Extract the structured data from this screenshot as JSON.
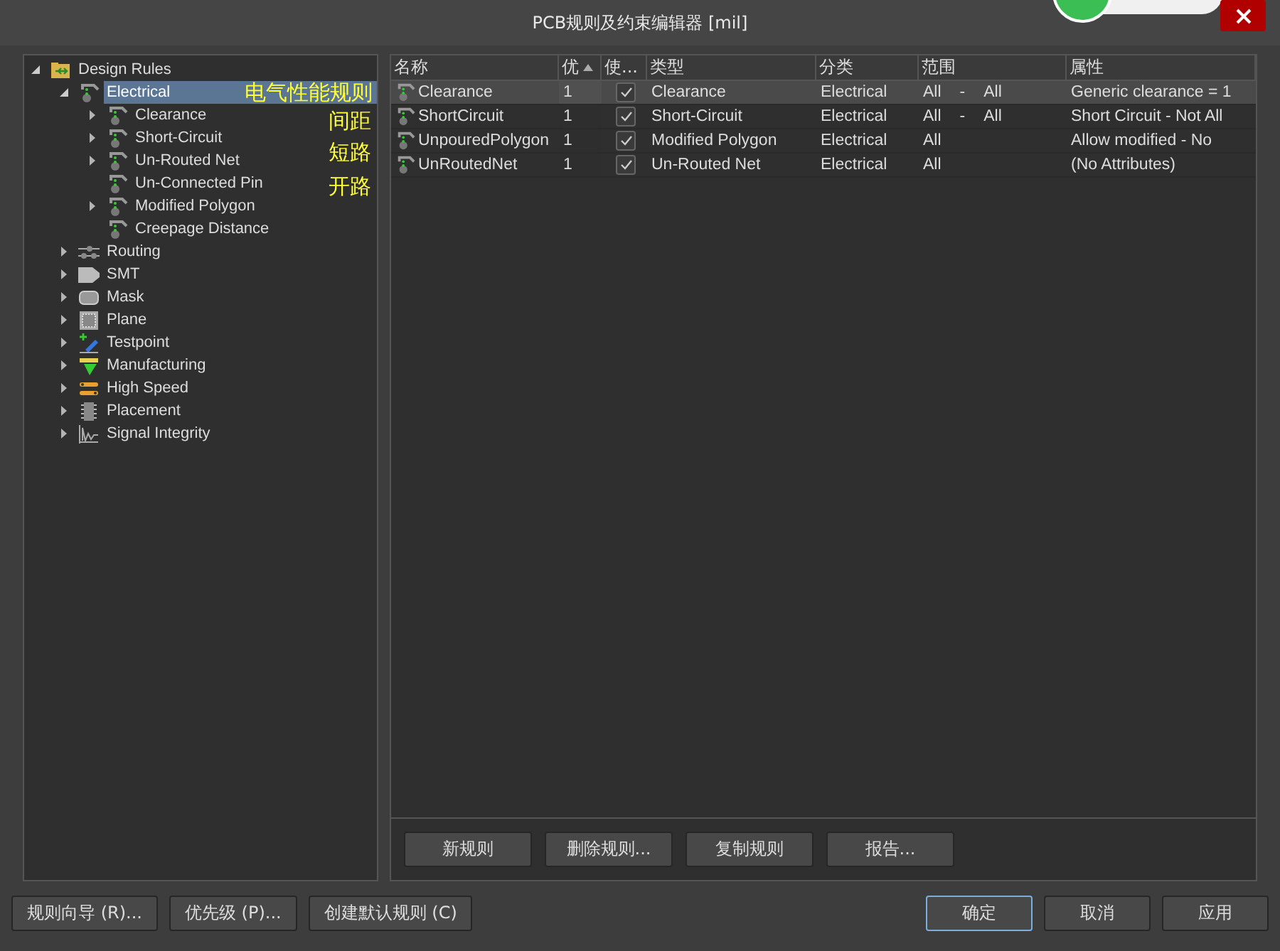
{
  "window": {
    "title": "PCB规则及约束编辑器 [mil]"
  },
  "tree": [
    {
      "label": "Design Rules",
      "kind": "folder",
      "expanded": true,
      "selected": false,
      "children": [
        {
          "label": "Electrical",
          "kind": "rule",
          "expanded": true,
          "selected": true,
          "children": [
            {
              "label": "Clearance",
              "kind": "rule",
              "expanded": false,
              "selected": false
            },
            {
              "label": "Short-Circuit",
              "kind": "rule",
              "expanded": false,
              "selected": false
            },
            {
              "label": "Un-Routed Net",
              "kind": "rule",
              "expanded": false,
              "selected": false
            },
            {
              "label": "Un-Connected Pin",
              "kind": "rule",
              "selected": false
            },
            {
              "label": "Modified Polygon",
              "kind": "rule",
              "expanded": false,
              "selected": false
            },
            {
              "label": "Creepage Distance",
              "kind": "rule",
              "selected": false
            }
          ]
        },
        {
          "label": "Routing",
          "kind": "routing",
          "expanded": false,
          "selected": false
        },
        {
          "label": "SMT",
          "kind": "smt",
          "expanded": false,
          "selected": false
        },
        {
          "label": "Mask",
          "kind": "mask",
          "expanded": false,
          "selected": false
        },
        {
          "label": "Plane",
          "kind": "plane",
          "expanded": false,
          "selected": false
        },
        {
          "label": "Testpoint",
          "kind": "testpoint",
          "expanded": false,
          "selected": false
        },
        {
          "label": "Manufacturing",
          "kind": "manufacturing",
          "expanded": false,
          "selected": false
        },
        {
          "label": "High Speed",
          "kind": "highspeed",
          "expanded": false,
          "selected": false
        },
        {
          "label": "Placement",
          "kind": "placement",
          "expanded": false,
          "selected": false
        },
        {
          "label": "Signal Integrity",
          "kind": "signal",
          "expanded": false,
          "selected": false
        }
      ]
    }
  ],
  "annotations": [
    "电气性能规则",
    "间距",
    "短路",
    "开路"
  ],
  "table": {
    "columns": [
      {
        "label": "名称",
        "sorted": false
      },
      {
        "label": "优",
        "sorted": true
      },
      {
        "label": "使...",
        "sorted": false
      },
      {
        "label": "类型",
        "sorted": false
      },
      {
        "label": "分类",
        "sorted": false
      },
      {
        "label": "范围",
        "sorted": false
      },
      {
        "label": "属性",
        "sorted": false
      }
    ],
    "rows": [
      {
        "name": "Clearance",
        "priority": "1",
        "enabled": true,
        "type": "Clearance",
        "category": "Electrical",
        "scope": [
          "All",
          "-",
          "All"
        ],
        "attributes": "Generic clearance = 1",
        "selected": true
      },
      {
        "name": "ShortCircuit",
        "priority": "1",
        "enabled": true,
        "type": "Short-Circuit",
        "category": "Electrical",
        "scope": [
          "All",
          "-",
          "All"
        ],
        "attributes": "Short Circuit - Not All",
        "selected": false
      },
      {
        "name": "UnpouredPolygon",
        "priority": "1",
        "enabled": true,
        "type": "Modified Polygon",
        "category": "Electrical",
        "scope": [
          "All"
        ],
        "attributes": "Allow modified - No",
        "selected": false
      },
      {
        "name": "UnRoutedNet",
        "priority": "1",
        "enabled": true,
        "type": "Un-Routed Net",
        "category": "Electrical",
        "scope": [
          "All"
        ],
        "attributes": "(No Attributes)",
        "selected": false
      }
    ]
  },
  "table_buttons": [
    "新规则",
    "删除规则...",
    "复制规则",
    "报告..."
  ],
  "footer_buttons": [
    {
      "label": "规则向导 (R)...",
      "default": false
    },
    {
      "label": "优先级 (P)...",
      "default": false
    },
    {
      "label": "创建默认规则 (C)",
      "default": false
    },
    {
      "label": "确定",
      "default": true
    },
    {
      "label": "取消",
      "default": false
    },
    {
      "label": "应用",
      "default": false
    }
  ]
}
